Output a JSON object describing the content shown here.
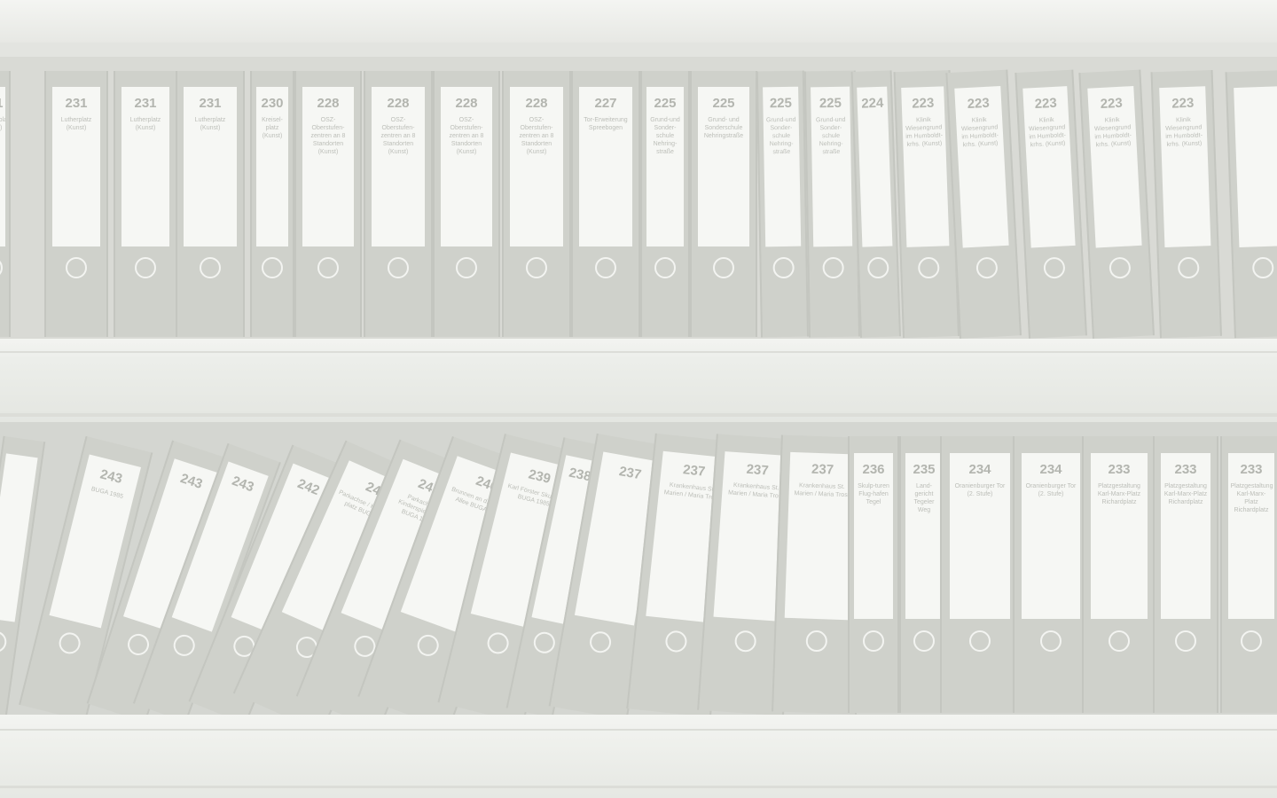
{
  "shelf_top": {
    "binders": [
      {
        "number": "231",
        "title": "Lutherplatz (Kunst)"
      },
      {
        "number": "231",
        "title": "Lutherplatz (Kunst)"
      },
      {
        "number": "231",
        "title": "Lutherplatz (Kunst)"
      },
      {
        "number": "231",
        "title": "Lutherplatz (Kunst)"
      },
      {
        "number": "230",
        "title": "Kreisel-platz (Kunst)"
      },
      {
        "number": "228",
        "title": "OSZ-Oberstufen-zentren an 8 Standorten (Kunst)"
      },
      {
        "number": "228",
        "title": "OSZ-Oberstufen-zentren an 8 Standorten (Kunst)"
      },
      {
        "number": "228",
        "title": "OSZ-Oberstufen-zentren an 8 Standorten (Kunst)"
      },
      {
        "number": "228",
        "title": "OSZ-Oberstufen-zentren an 8 Standorten (Kunst)"
      },
      {
        "number": "227",
        "title": "Tor-Erweiterung Spreebogen"
      },
      {
        "number": "225",
        "title": "Grund-und Sonder-schule Nehring-straße"
      },
      {
        "number": "225",
        "title": "Grund- und Sonderschule Nehringstraße"
      },
      {
        "number": "225",
        "title": "Grund-und Sonder-schule Nehring-straße"
      },
      {
        "number": "225",
        "title": "Grund-und Sonder-schule Nehring-straße"
      },
      {
        "number": "224",
        "title": ""
      },
      {
        "number": "223",
        "title": "Klinik Wiesengrund im Humboldt-krhs. (Kunst)"
      },
      {
        "number": "223",
        "title": "Klinik Wiesengrund im Humboldt-krhs. (Kunst)"
      },
      {
        "number": "223",
        "title": "Klinik Wiesengrund im Humboldt-krhs. (Kunst)"
      },
      {
        "number": "223",
        "title": "Klinik Wiesengrund im Humboldt-krhs. (Kunst)"
      },
      {
        "number": "223",
        "title": "Klinik Wiesengrund im Humboldt-krhs. (Kunst)"
      },
      {
        "number": "",
        "title": ""
      }
    ]
  },
  "shelf_bottom": {
    "binders": [
      {
        "number": "",
        "title": ""
      },
      {
        "number": "243",
        "title": "BUGA 1985"
      },
      {
        "number": "243",
        "title": ""
      },
      {
        "number": "243",
        "title": ""
      },
      {
        "number": "242",
        "title": ""
      },
      {
        "number": "241",
        "title": "Parkachse / Kinderspiel-platz BUGA 1985"
      },
      {
        "number": "241",
        "title": "Parkachse / Kinderspiel-platz BUGA 1985"
      },
      {
        "number": "240",
        "title": "Brunnen an d. Mittelen Allee BUGA 1985"
      },
      {
        "number": "239",
        "title": "Karl Förster Skulptur BUGA 1985"
      },
      {
        "number": "238",
        "title": ""
      },
      {
        "number": "237",
        "title": ""
      },
      {
        "number": "237",
        "title": "Krankenhaus St. Marien / Maria Trost"
      },
      {
        "number": "237",
        "title": "Krankenhaus St. Marien / Maria Trost"
      },
      {
        "number": "237",
        "title": "Krankenhaus St. Marien / Maria Trost"
      },
      {
        "number": "236",
        "title": "Skulp-turen Flug-hafen Tegel"
      },
      {
        "number": "235",
        "title": "Land-gericht Tegeler Weg"
      },
      {
        "number": "234",
        "title": "Oranienburger Tor (2. Stufe)"
      },
      {
        "number": "234",
        "title": "Oranienburger Tor (2. Stufe)"
      },
      {
        "number": "233",
        "title": "Platzgestaltung Karl-Marx-Platz Richardplatz"
      },
      {
        "number": "233",
        "title": "Platzgestaltung Karl-Marx-Platz Richardplatz"
      },
      {
        "number": "233",
        "title": "Platzgestaltung Karl-Marx-Platz Richardplatz"
      }
    ]
  }
}
